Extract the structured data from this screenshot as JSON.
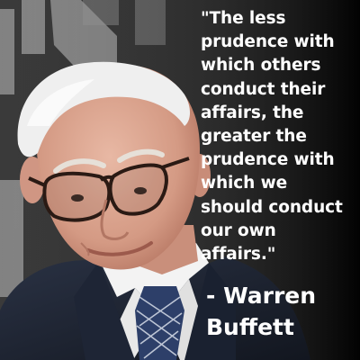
{
  "quote": {
    "lines": [
      "\"The less",
      "prudence with",
      "which others",
      "conduct their",
      "affairs, the",
      "greater the",
      "prudence with",
      "which we",
      "should conduct",
      "our own",
      "affairs.\""
    ]
  },
  "attribution": {
    "lines": [
      "- Warren",
      "Buffett"
    ]
  },
  "colors": {
    "text": "#ffffff",
    "background": "#0b0b0b",
    "suit": "#1b2233",
    "shirt": "#f2f2f2",
    "tie": "#2c3e66",
    "skin": "#d9a48f",
    "hair": "#eeeeee"
  }
}
